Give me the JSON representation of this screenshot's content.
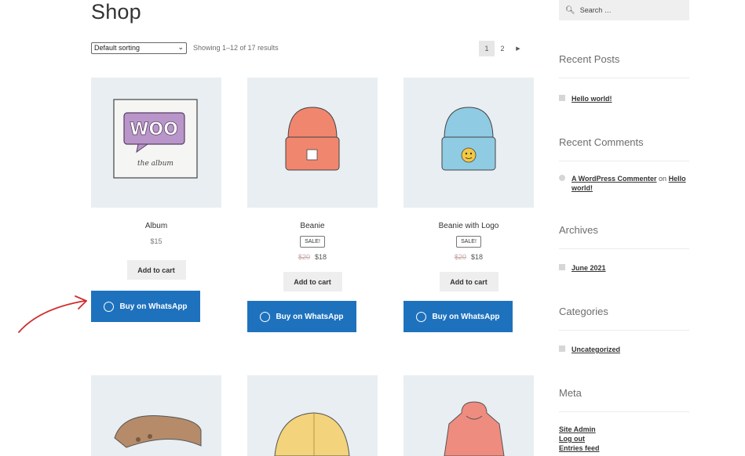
{
  "page": {
    "title": "Shop"
  },
  "toolbar": {
    "sort_value": "Default sorting",
    "result_count": "Showing 1–12 of 17 results",
    "pages": [
      "1",
      "2"
    ],
    "next_glyph": "▶"
  },
  "products": [
    {
      "name": "Album",
      "price": "$15",
      "cart_label": "Add to cart",
      "whatsapp_label": "Buy on WhatsApp"
    },
    {
      "name": "Beanie",
      "sale_badge": "SALE!",
      "old_price": "$20",
      "price": "$18",
      "cart_label": "Add to cart",
      "whatsapp_label": "Buy on WhatsApp"
    },
    {
      "name": "Beanie with Logo",
      "sale_badge": "SALE!",
      "old_price": "$20",
      "price": "$18",
      "cart_label": "Add to cart",
      "whatsapp_label": "Buy on WhatsApp"
    }
  ],
  "album_art": {
    "logo": "WOO",
    "caption": "the album"
  },
  "sidebar": {
    "search_placeholder": "Search …",
    "recent_posts": {
      "title": "Recent Posts",
      "items": [
        "Hello world!"
      ]
    },
    "recent_comments": {
      "title": "Recent Comments",
      "author": "A WordPress Commenter",
      "on": "on",
      "post": "Hello world!"
    },
    "archives": {
      "title": "Archives",
      "items": [
        "June 2021"
      ]
    },
    "categories": {
      "title": "Categories",
      "items": [
        "Uncategorized"
      ]
    },
    "meta": {
      "title": "Meta",
      "items": [
        "Site Admin",
        "Log out",
        "Entries feed"
      ]
    }
  },
  "colors": {
    "whatsapp_button": "#1e72bd",
    "thumb_bg": "#e8eef2",
    "annotation_arrow": "#d32b2b"
  }
}
